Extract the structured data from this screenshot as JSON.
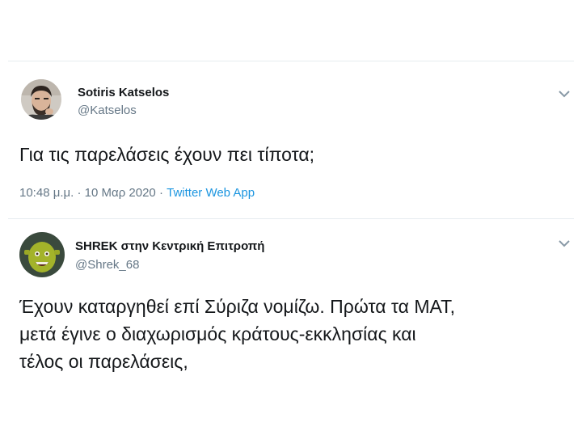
{
  "tweets": [
    {
      "display_name": "Sotiris Katselos",
      "handle": "@Katselos",
      "text": "Για τις παρελάσεις έχουν πει τίποτα;",
      "time": "10:48 μ.μ.",
      "separator": "·",
      "date": "10 Μαρ 2020",
      "source": "Twitter Web App",
      "avatar_icon": "profile-photo-man-icon",
      "menu_icon": "chevron-down-icon"
    },
    {
      "display_name": "SHREK στην Κεντρική Επιτροπή",
      "handle": "@Shrek_68",
      "text_lines": [
        "Έχουν καταργηθεί επί Σύριζα νομίζω. Πρώτα τα ΜΑΤ,",
        "μετά έγινε ο διαχωρισμός κράτους-εκκλησίας και",
        "τέλος οι παρελάσεις,"
      ],
      "avatar_icon": "profile-photo-shrek-icon",
      "menu_icon": "chevron-down-icon"
    }
  ],
  "colors": {
    "text": "#14171a",
    "secondary": "#657786",
    "link": "#1b95e0",
    "divider": "#e6ecf0"
  }
}
